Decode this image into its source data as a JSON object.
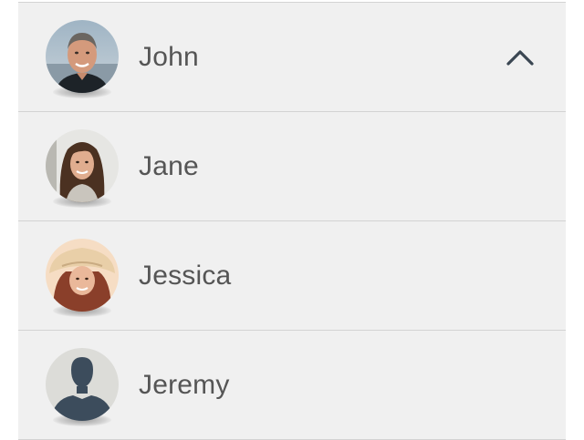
{
  "contacts": [
    {
      "name": "John",
      "avatar": "john-photo",
      "expanded": true
    },
    {
      "name": "Jane",
      "avatar": "jane-photo"
    },
    {
      "name": "Jessica",
      "avatar": "jessica-photo"
    },
    {
      "name": "Jeremy",
      "avatar": "default-silhouette"
    }
  ],
  "icons": {
    "expand_state": "chevron-up-icon"
  },
  "colors": {
    "row_background": "#f0f0f0",
    "divider": "#d3d3d3",
    "name_text": "#555555",
    "chevron": "#3a4652"
  }
}
